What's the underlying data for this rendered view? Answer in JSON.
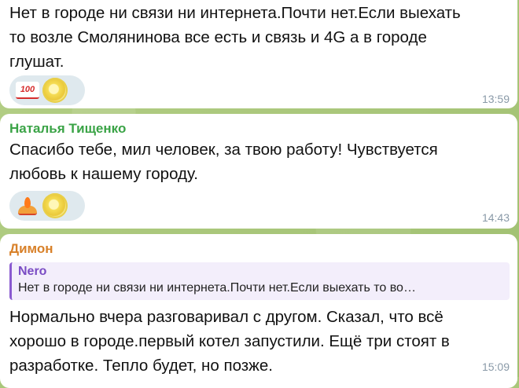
{
  "messages": [
    {
      "sender": "",
      "text": "Нет в городе ни связи ни интернета.Почти нет.Если выехать\nто возле Смолянинова все есть и связь и 4G а в городе\nглушат.",
      "reactions": [
        "100",
        "lemon"
      ],
      "time": "13:59"
    },
    {
      "sender": "Наталья Тищенко",
      "text": "Спасибо тебе, мил человек, за твою работу! Чувствуется\nлюбовь к нашему городу.",
      "reactions": [
        "fire",
        "lemon"
      ],
      "time": "14:43"
    },
    {
      "sender": "Димон",
      "reply": {
        "name": "Nero",
        "text": "Нет в городе ни связи ни интернета.Почти нет.Если выехать то во…"
      },
      "text": "Нормально вчера разговаривал с другом. Сказал, что всё\nхорошо в городе.первый котел запустили. Ещё три стоят в\nразработке. Тепло будет, но позже.",
      "time": "15:09"
    }
  ],
  "icons": {
    "reaction_100": "hundred-points-icon",
    "reaction_lemon": "lemon-icon",
    "reaction_fire": "fire-icon"
  }
}
